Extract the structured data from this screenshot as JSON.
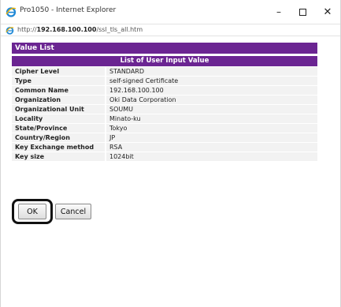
{
  "window": {
    "title": "Pro1050 - Internet Explorer",
    "minimize_glyph": "–",
    "close_glyph": "✕"
  },
  "address": {
    "prefix": "http://",
    "host": "192.168.100.100",
    "path": "/ssl_tls_all.htm"
  },
  "panel": {
    "title": "Value List",
    "caption": "List of User Input Value",
    "rows": [
      {
        "key": "Cipher Level",
        "value": "STANDARD"
      },
      {
        "key": "Type",
        "value": "self-signed Certificate"
      },
      {
        "key": "Common Name",
        "value": "192.168.100.100"
      },
      {
        "key": "Organization",
        "value": "Oki Data Corporation"
      },
      {
        "key": "Organizational Unit",
        "value": "SOUMU"
      },
      {
        "key": "Locality",
        "value": "Minato-ku"
      },
      {
        "key": "State/Province",
        "value": "Tokyo"
      },
      {
        "key": "Country/Region",
        "value": "JP"
      },
      {
        "key": "Key Exchange method",
        "value": "RSA"
      },
      {
        "key": "Key size",
        "value": "1024bit"
      }
    ]
  },
  "actions": {
    "ok_label": "OK",
    "cancel_label": "Cancel"
  },
  "colors": {
    "header_purple": "#6b2592",
    "row_background": "#f2f2f2"
  }
}
